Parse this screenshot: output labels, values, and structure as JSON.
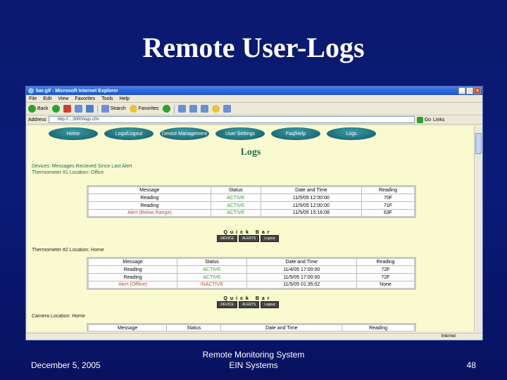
{
  "slide": {
    "title": "Remote User-Logs",
    "footer_left": "December 5, 2005",
    "footer_center_line1": "Remote Monitoring System",
    "footer_center_line2": "EIN Systems",
    "page_number": "48"
  },
  "browser": {
    "window_title": "bar.gif - Microsoft Internet Explorer",
    "menu": [
      "File",
      "Edit",
      "View",
      "Favorites",
      "Tools",
      "Help"
    ],
    "toolbar": {
      "back": "Back",
      "search": "Search",
      "favorites": "Favorites"
    },
    "address_label": "Address",
    "address_value": "http://...:3000/logs.cfm",
    "go_label": "Go",
    "links_label": "Links",
    "status_zone": "Internet"
  },
  "page": {
    "nav": [
      {
        "label": "Home"
      },
      {
        "label": "Logs/Logout"
      },
      {
        "label": "Device Management"
      },
      {
        "label": "User Settings"
      },
      {
        "label": "Faq/Help"
      },
      {
        "label": "Logs"
      }
    ],
    "heading": "Logs",
    "devices_label": "Devices: Messages Recieved Since Last Alert",
    "sections": [
      {
        "label": "Thermometer #1 Location: Office",
        "headers": [
          "Message",
          "Status",
          "Date and Time",
          "Reading"
        ],
        "rows": [
          [
            "Reading",
            "ACTIVE",
            "11/5/05 12:00:00",
            "70F"
          ],
          [
            "Reading",
            "ACTIVE",
            "11/5/05 12:00:00",
            "71F"
          ],
          [
            "Alert (Below Range)",
            "ACTIVE",
            "11/5/05 15:16:08",
            "63F"
          ]
        ]
      },
      {
        "label": "Thermometer #2 Location: Home",
        "headers": [
          "Message",
          "Status",
          "Date and Time",
          "Reading"
        ],
        "rows": [
          [
            "Reading",
            "ACTIVE",
            "11/4/05 17:00:00",
            "72F"
          ],
          [
            "Reading",
            "ACTIVE",
            "11/5/05 17:00:00",
            "72F"
          ],
          [
            "Alert (Offline)",
            "INACTIVE",
            "11/5/05 01:35:02",
            "None"
          ]
        ]
      },
      {
        "label": "Camera Location: Home",
        "headers": [
          "Message",
          "Status",
          "Date and Time",
          "Reading"
        ],
        "rows": []
      }
    ],
    "quickbar": {
      "title": "Quick Bar",
      "buttons": [
        "DEVICE",
        "ALERTS",
        "Logout"
      ]
    }
  }
}
